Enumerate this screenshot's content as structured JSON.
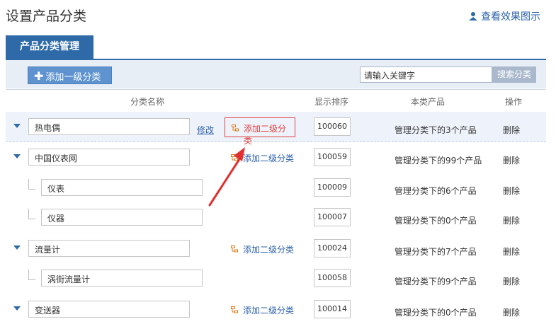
{
  "header": {
    "title": "设置产品分类",
    "view_demo": "查看效果图示"
  },
  "tabs": [
    {
      "label": "产品分类管理",
      "active": true
    }
  ],
  "toolbar": {
    "add_label": "添加一级分类",
    "search_placeholder": "请输入关键字",
    "search_button": "搜索分类"
  },
  "table": {
    "headers": {
      "name": "分类名称",
      "order": "显示排序",
      "products": "本类产品",
      "actions": "操作"
    },
    "edit_label": "修改",
    "add_sub_label": "添加二级分类",
    "delete_label": "删除",
    "rows": [
      {
        "name": "热电偶",
        "order": "100060",
        "products": "管理分类下的3个产品",
        "level": 1,
        "has_edit": true
      },
      {
        "name": "中国仪表网",
        "order": "100059",
        "products": "管理分类下的99个产品",
        "level": 1
      },
      {
        "name": "仪表",
        "order": "100009",
        "products": "管理分类下的6个产品",
        "level": 2
      },
      {
        "name": "仪器",
        "order": "100007",
        "products": "管理分类下的0个产品",
        "level": 2
      },
      {
        "name": "流量计",
        "order": "100024",
        "products": "管理分类下的7个产品",
        "level": 1
      },
      {
        "name": "涡街流量计",
        "order": "100058",
        "products": "管理分类下的9个产品",
        "level": 2
      },
      {
        "name": "变送器",
        "order": "100014",
        "products": "管理分类下的0个产品",
        "level": 1
      }
    ]
  },
  "colors": {
    "accent": "#2f6aa8",
    "annotation": "#e03030"
  }
}
